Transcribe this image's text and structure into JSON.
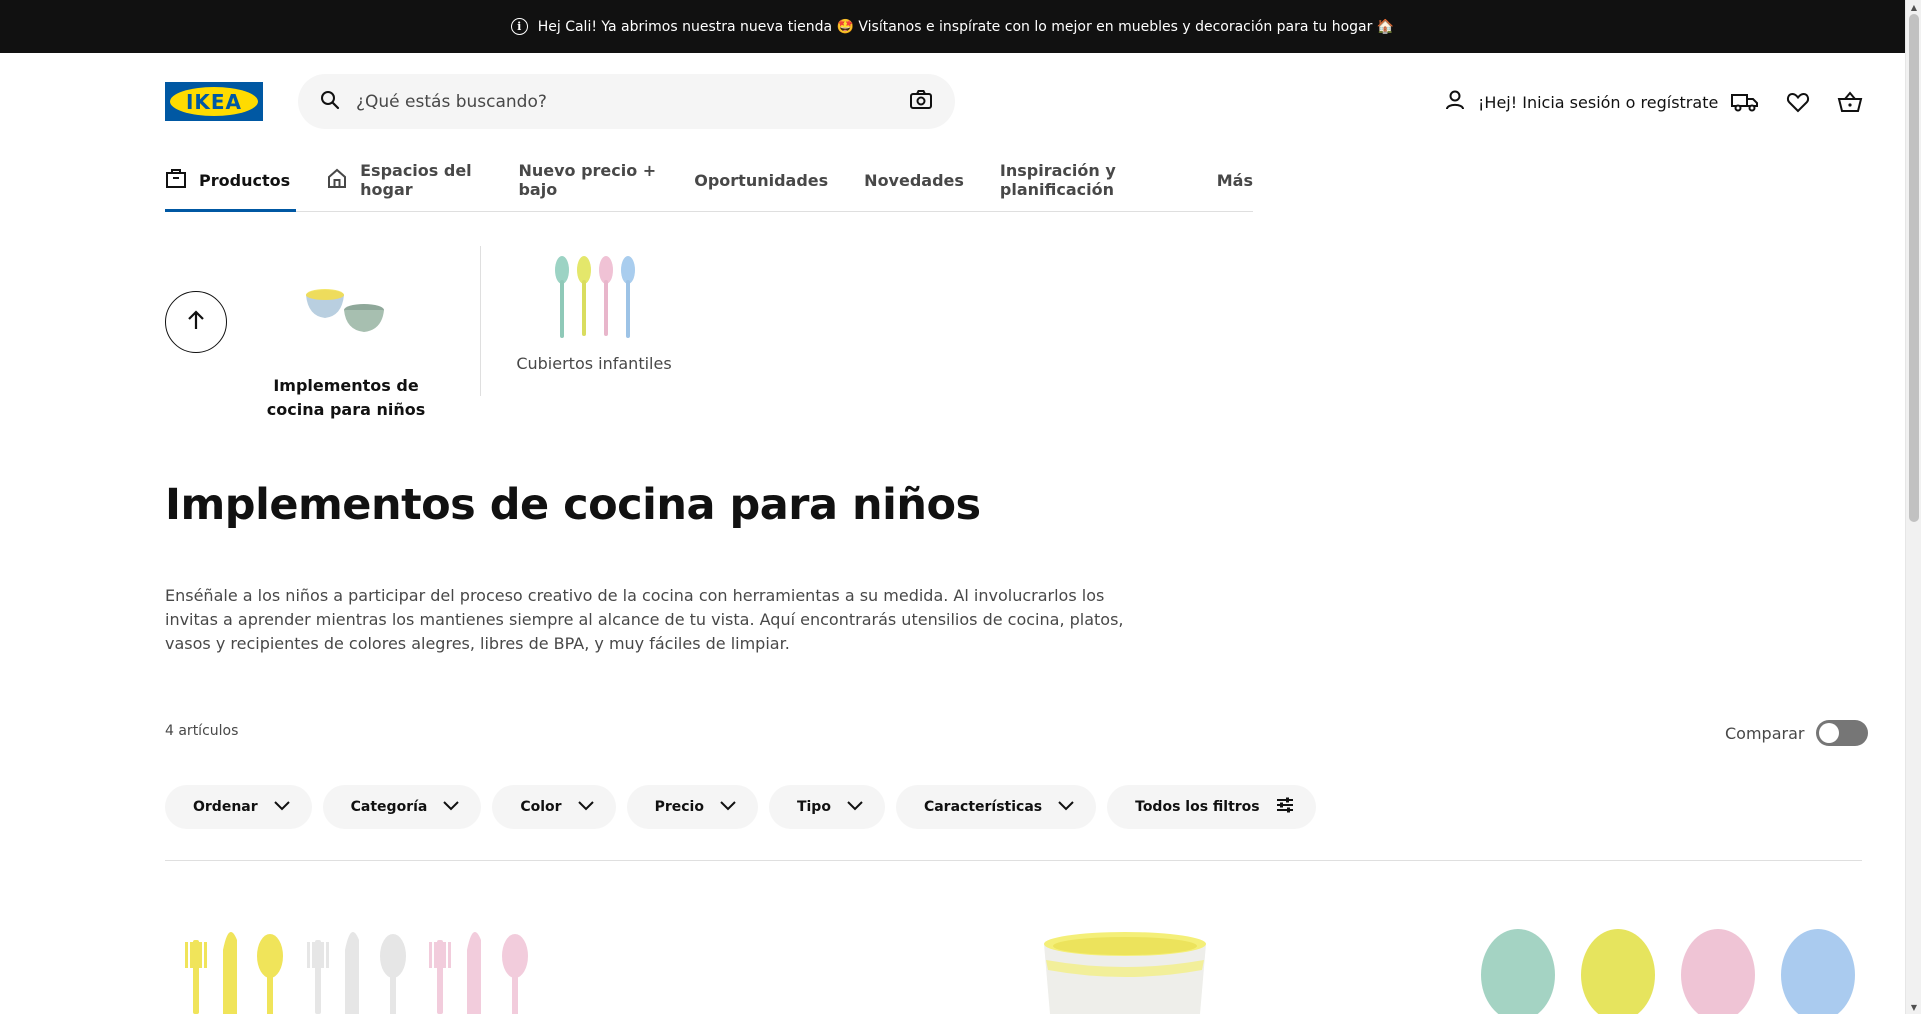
{
  "banner": {
    "text": "Hej Cali! Ya abrimos nuestra nueva tienda 🤩 Visítanos e inspírate con lo mejor en muebles y decoración para tu hogar 🏠",
    "info_icon": "info-circle-icon"
  },
  "header": {
    "logo_text": "IKEA",
    "search_placeholder": "¿Qué estás buscando?",
    "login_label": "¡Hej! Inicia sesión o regístrate",
    "icons": [
      "search-icon",
      "camera-icon",
      "user-icon",
      "truck-icon",
      "heart-icon",
      "basket-icon"
    ]
  },
  "nav": {
    "items": [
      {
        "label": "Productos",
        "active": true,
        "icon": "bag-icon"
      },
      {
        "label": "Espacios del hogar",
        "icon": "home-icon"
      },
      {
        "label": "Nuevo precio + bajo"
      },
      {
        "label": "Oportunidades"
      },
      {
        "label": "Novedades"
      },
      {
        "label": "Inspiración y planificación"
      },
      {
        "label": "Más"
      }
    ]
  },
  "categories": {
    "items": [
      {
        "label": "Implementos de cocina para niños",
        "selected": true
      },
      {
        "label": "Cubiertos infantiles",
        "selected": false
      }
    ]
  },
  "page": {
    "title": "Implementos de cocina para niños",
    "description": "Enséñale a los niños a participar del proceso creativo de la cocina con herramientas a su medida. Al involucrarlos los invitas a aprender mientras los mantienes siempre al alcance de tu vista. Aquí encontrarás utensilios de cocina, platos, vasos y recipientes de colores alegres, libres de BPA, y muy fáciles de limpiar.",
    "count": "4 artículos",
    "compare_label": "Comparar"
  },
  "filters": {
    "items": [
      "Ordenar",
      "Categoría",
      "Color",
      "Precio",
      "Tipo",
      "Características",
      "Todos los filtros"
    ]
  },
  "colors": {
    "brand_blue": "#0058a3",
    "brand_yellow": "#ffdb00",
    "banner_bg": "#111111",
    "chip_bg": "#f5f5f5"
  }
}
